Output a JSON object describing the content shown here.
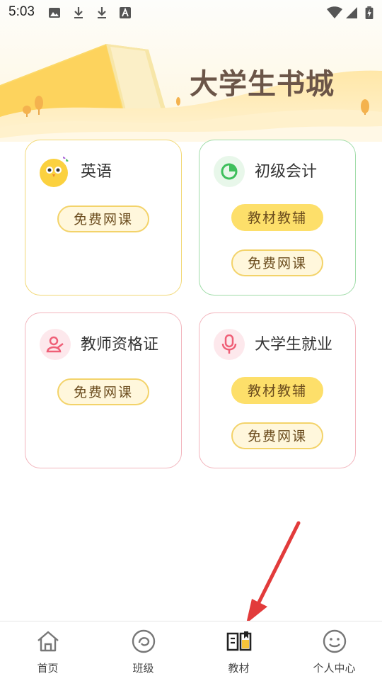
{
  "status_bar": {
    "time": "5:03"
  },
  "banner": {
    "title": "大学生书城"
  },
  "cards": [
    {
      "title": "英语",
      "buttons": [
        "免费网课"
      ]
    },
    {
      "title": "初级会计",
      "buttons": [
        "教材教辅",
        "免费网课"
      ]
    },
    {
      "title": "教师资格证",
      "buttons": [
        "免费网课"
      ]
    },
    {
      "title": "大学生就业",
      "buttons": [
        "教材教辅",
        "免费网课"
      ]
    }
  ],
  "nav": [
    {
      "label": "首页",
      "icon": "home-icon"
    },
    {
      "label": "班级",
      "icon": "class-icon"
    },
    {
      "label": "教材",
      "icon": "book-icon",
      "active": true
    },
    {
      "label": "个人中心",
      "icon": "smiley-icon"
    }
  ],
  "colors": {
    "accent": "#fddf6a",
    "pill_border": "#f3d36a",
    "arrow": "#e23b3b"
  }
}
